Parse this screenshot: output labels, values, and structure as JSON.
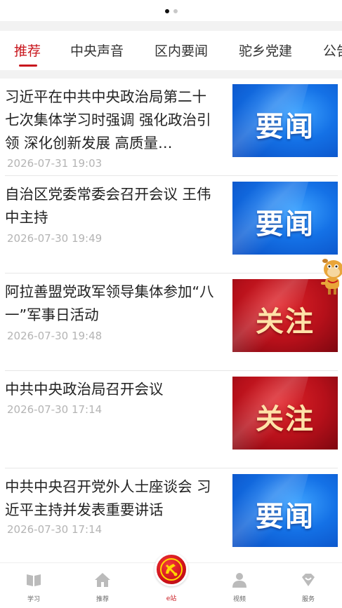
{
  "tabs": [
    {
      "label": "推荐",
      "active": true
    },
    {
      "label": "中央声音"
    },
    {
      "label": "区内要闻"
    },
    {
      "label": "驼乡党建"
    },
    {
      "label": "公告"
    }
  ],
  "news": [
    {
      "title": "习近平在中共中央政治局第二十七次集体学习时强调 强化政治引领 深化创新发展 高质量…",
      "time": "2026-07-31 19:03",
      "thumb": "要闻",
      "thumb_style": "blue"
    },
    {
      "title": "自治区党委常委会召开会议 王伟中主持",
      "time": "2026-07-30 19:49",
      "thumb": "要闻",
      "thumb_style": "blue"
    },
    {
      "title": "阿拉善盟党政军领导集体参加“八一”军事日活动",
      "time": "2026-07-30 19:48",
      "thumb": "关注",
      "thumb_style": "red"
    },
    {
      "title": "中共中央政治局召开会议",
      "time": "2026-07-30 17:14",
      "thumb": "关注",
      "thumb_style": "red"
    },
    {
      "title": "中共中央召开党外人士座谈会 习近平主持并发表重要讲话",
      "time": "2026-07-30 17:14",
      "thumb": "要闻",
      "thumb_style": "blue"
    }
  ],
  "bottom_nav": [
    {
      "label": "学习",
      "icon": "book-icon"
    },
    {
      "label": "推荐",
      "icon": "home-icon"
    },
    {
      "label": "e站",
      "icon": "party-emblem-icon"
    },
    {
      "label": "视频",
      "icon": "person-icon"
    },
    {
      "label": "服务",
      "icon": "heart-diamond-icon"
    }
  ],
  "colors": {
    "accent": "#c8161d",
    "blue_thumb": "#1471e6",
    "red_thumb": "#b6101a"
  }
}
